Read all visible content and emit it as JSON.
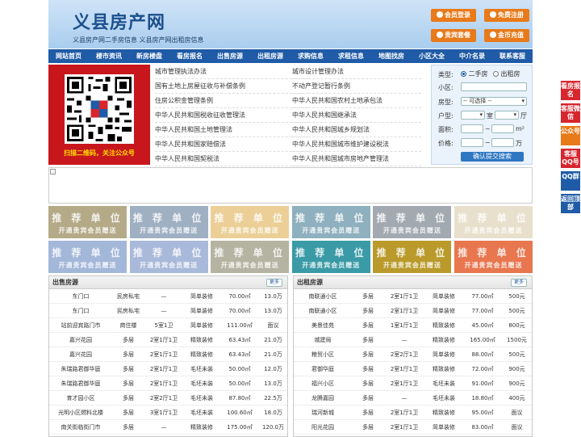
{
  "header": {
    "logo": "义县房产网",
    "subtitle": "义县房产网二手房信息   义县房产网出租房信息",
    "buttons": [
      "会员登录",
      "免费注册",
      "贵宾套餐",
      "金币充值"
    ]
  },
  "nav": [
    "网站首页",
    "楼市资讯",
    "新房楼盘",
    "看房报名",
    "出售房源",
    "出租房源",
    "求购信息",
    "求租信息",
    "地图找房",
    "小区大全",
    "中介名录",
    "联系客服"
  ],
  "qr": {
    "caption": "扫描二维码，关注公众号"
  },
  "laws": {
    "left": [
      "城市管理执法办法",
      "国有土地上房屋征收与补偿条例",
      "住房公积金管理条例",
      "中华人民共和国税收征收管理法",
      "中华人民共和国土地管理法",
      "中华人民共和国家赔偿法",
      "中华人民共和国契税法"
    ],
    "right": [
      "城市设计管理办法",
      "不动产登记暂行条例",
      "中华人民共和国农村土地承包法",
      "中华人民共和国继承法",
      "中华人民共和国城乡规划法",
      "中华人民共和国城市维护建设税法",
      "中华人民共和国城市房地产管理法"
    ]
  },
  "search": {
    "type_label": "类型:",
    "type_options": [
      "二手房",
      "出租房"
    ],
    "community_label": "小区:",
    "layout_label": "房型:",
    "layout_select": "-- 可选择 --",
    "room_label": "户型:",
    "room_unit1": "室",
    "room_unit2": "厅",
    "area_label": "面积:",
    "area_unit": "m²",
    "price_label": "价格:",
    "price_unit": "万",
    "range_sep": "~",
    "submit": "确认提交搜索"
  },
  "recommend": {
    "title": "推 荐 单 位",
    "subtitle": "开通贵宾会员赠送",
    "colors": [
      "#b5aa88",
      "#9fb0c3",
      "#ebcf96",
      "#8fb0be",
      "#a3a9b0",
      "#e8e0cc",
      "#a3b7d9",
      "#a9b9d9",
      "#b5b4a2",
      "#3a9aa6",
      "#b99a2a",
      "#e8764f"
    ]
  },
  "sale": {
    "title": "出售房源",
    "more": "更多",
    "rows": [
      [
        "东门口",
        "民房私宅",
        "—",
        "简单装修",
        "70.00㎡",
        "13.0万"
      ],
      [
        "东门口",
        "民房私宅",
        "—",
        "简单装修",
        "70.00㎡",
        "13.0万"
      ],
      [
        "站前迎宾路门市",
        "商住楼",
        "5室1卫",
        "简单装修",
        "111.00㎡",
        "面议"
      ],
      [
        "嘉兴花园",
        "多层",
        "2室1厅1卫",
        "精致装修",
        "63.43㎡",
        "21.0万"
      ],
      [
        "嘉兴花园",
        "多层",
        "2室1厅1卫",
        "精致装修",
        "63.43㎡",
        "21.0万"
      ],
      [
        "朱瑞路君御华庭",
        "多层",
        "2室1厅1卫",
        "毛坯未装",
        "50.00㎡",
        "12.0万"
      ],
      [
        "朱瑞路君御华庭",
        "多层",
        "2室1厅1卫",
        "毛坯未装",
        "50.00㎡",
        "13.0万"
      ],
      [
        "育才园小区",
        "多层",
        "2室2厅1卫",
        "毛坯未装",
        "87.80㎡",
        "22.5万"
      ],
      [
        "光明小区燃料北楼",
        "多层",
        "3室1厅1卫",
        "毛坯未装",
        "100.60㎡",
        "18.0万"
      ],
      [
        "南关街临街门市",
        "多层",
        "—",
        "精致装修",
        "175.00㎡",
        "120.0万"
      ]
    ]
  },
  "rent": {
    "title": "出租房源",
    "more": "更多",
    "rows": [
      [
        "南联通小区",
        "多层",
        "2室1厅1卫",
        "简单装修",
        "77.00㎡",
        "500元"
      ],
      [
        "南联通小区",
        "多层",
        "2室1厅1卫",
        "简单装修",
        "77.00㎡",
        "500元"
      ],
      [
        "美景佳苑",
        "多层",
        "1室1厅1卫",
        "精致装修",
        "45.00㎡",
        "800元"
      ],
      [
        "城建局",
        "多层",
        "—",
        "精致装修",
        "165.00㎡",
        "1500元"
      ],
      [
        "粮贸小区",
        "多层",
        "2室2厅1卫",
        "简单装修",
        "88.00㎡",
        "500元"
      ],
      [
        "君御华庭",
        "多层",
        "2室1厅1卫",
        "精致装修",
        "72.00㎡",
        "900元"
      ],
      [
        "福兴小区",
        "多层",
        "2室1厅1卫",
        "毛坯未装",
        "91.00㎡",
        "900元"
      ],
      [
        "龙腾嘉园",
        "多层",
        "—",
        "毛坯未装",
        "18.80㎡",
        "400元"
      ],
      [
        "瑞河新城",
        "多层",
        "2室1厅1卫",
        "精致装修",
        "95.00㎡",
        "面议"
      ],
      [
        "阳光花园",
        "多层",
        "2室1厅1卫",
        "简单装修",
        "83.00㎡",
        "面议"
      ]
    ]
  },
  "side": [
    {
      "label": "看房报名",
      "color": "#d7262e"
    },
    {
      "label": "客服微信",
      "color": "#d7262e"
    },
    {
      "label": "公众号",
      "color": "#e87a1a"
    },
    {
      "label": "客服QQ号",
      "color": "#d7262e"
    },
    {
      "label": "QQ群",
      "color": "#1f5ba6"
    },
    {
      "label": "返回顶部",
      "color": "#1f5ba6"
    }
  ]
}
